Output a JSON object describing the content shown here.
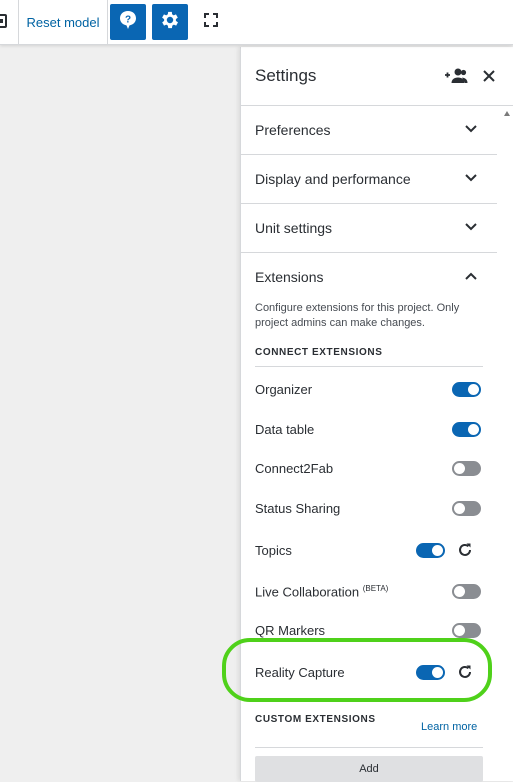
{
  "toolbar": {
    "reset_label": "Reset model",
    "help_icon": "help-bubble-icon",
    "settings_icon": "gear-icon",
    "fullscreen_icon": "fullscreen-icon",
    "accent": "#0a66b3"
  },
  "panel": {
    "title": "Settings",
    "share_icon": "add-user-icon",
    "close_icon": "close-icon",
    "sections": [
      {
        "label": "Preferences",
        "expanded": false
      },
      {
        "label": "Display and performance",
        "expanded": false
      },
      {
        "label": "Unit settings",
        "expanded": false
      },
      {
        "label": "Extensions",
        "expanded": true
      }
    ],
    "extensions": {
      "description": "Configure extensions for this project. Only project admins can make changes.",
      "connect_title": "CONNECT EXTENSIONS",
      "items": [
        {
          "label": "Organizer",
          "enabled": true,
          "refresh": false
        },
        {
          "label": "Data table",
          "enabled": true,
          "refresh": false
        },
        {
          "label": "Connect2Fab",
          "enabled": false,
          "refresh": false
        },
        {
          "label": "Status Sharing",
          "enabled": false,
          "refresh": false
        },
        {
          "label": "Topics",
          "enabled": true,
          "refresh": true
        },
        {
          "label": "Live Collaboration",
          "sup": "(BETA)",
          "enabled": false,
          "refresh": false
        },
        {
          "label": "QR Markers",
          "enabled": false,
          "refresh": false
        },
        {
          "label": "Reality Capture",
          "enabled": true,
          "refresh": true
        }
      ],
      "custom_title": "CUSTOM EXTENSIONS",
      "learn_more": "Learn more",
      "add_label": "Add"
    }
  },
  "colors": {
    "toggle_on": "#0a66b3",
    "toggle_off": "#8a8d92",
    "link": "#0063a3",
    "highlight": "#4fd11a"
  }
}
